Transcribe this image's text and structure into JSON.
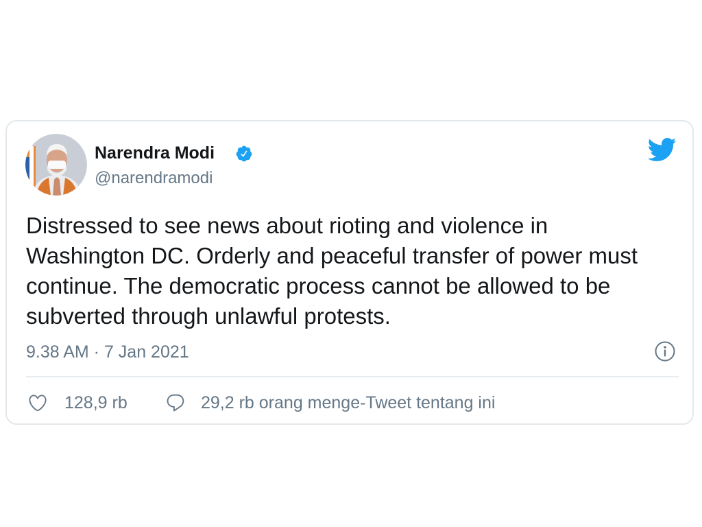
{
  "tweet": {
    "author": {
      "name": "Narendra Modi",
      "handle": "@narendramodi",
      "verified": true
    },
    "text_lines": [
      "Distressed to see news about rioting and violence in",
      "Washington DC. Orderly and peaceful transfer of power must",
      "continue. The democratic process cannot be allowed to be",
      "subverted through unlawful protests."
    ],
    "timestamp": "9.38 AM · 7 Jan 2021",
    "likes": "128,9 rb",
    "retweets_label": "29,2 rb orang menge-Tweet tentang ini"
  },
  "icons": {
    "verified": "verified-badge-icon",
    "brand": "twitter-bird-icon",
    "info": "info-icon",
    "like": "heart-icon",
    "reply": "comment-icon"
  },
  "colors": {
    "brand_blue": "#1da1f2",
    "text_primary": "#14171a",
    "text_secondary": "#657786",
    "border": "#e3e8ec"
  }
}
